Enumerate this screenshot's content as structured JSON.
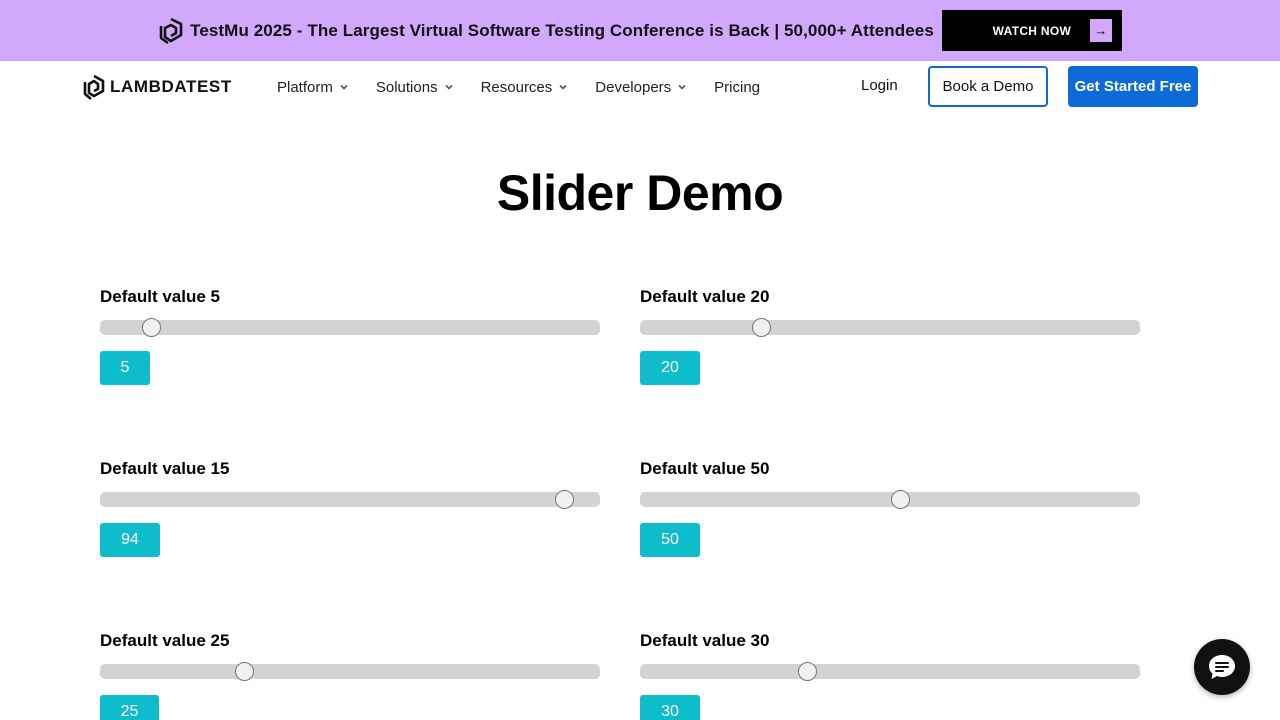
{
  "banner": {
    "text": "TestMu 2025 - The Largest Virtual Software Testing Conference is Back | 50,000+ Attendees",
    "button_label": "WATCH NOW",
    "arrow": "→",
    "background": "#d2a8fd"
  },
  "header": {
    "logo_text": "LAMBDATEST",
    "nav": [
      {
        "label": "Platform",
        "has_dropdown": true
      },
      {
        "label": "Solutions",
        "has_dropdown": true
      },
      {
        "label": "Resources",
        "has_dropdown": true
      },
      {
        "label": "Developers",
        "has_dropdown": true
      },
      {
        "label": "Pricing",
        "has_dropdown": false
      }
    ],
    "login_label": "Login",
    "demo_label": "Book a Demo",
    "cta_label": "Get Started Free",
    "accent": "#0d6bd9"
  },
  "page_title": "Slider Demo",
  "sliders": [
    {
      "label": "Default value 5",
      "value": 5,
      "output": "5"
    },
    {
      "label": "Default value 20",
      "value": 20,
      "output": "20"
    },
    {
      "label": "Default value 15",
      "value": 94,
      "output": "94"
    },
    {
      "label": "Default value 50",
      "value": 50,
      "output": "50"
    },
    {
      "label": "Default value 25",
      "value": 25,
      "output": "25"
    },
    {
      "label": "Default value 30",
      "value": 30,
      "output": "30"
    }
  ],
  "slider_range": [
    0,
    100
  ],
  "output_color": "#0fbccc",
  "chat": {
    "icon": "chat-icon"
  }
}
